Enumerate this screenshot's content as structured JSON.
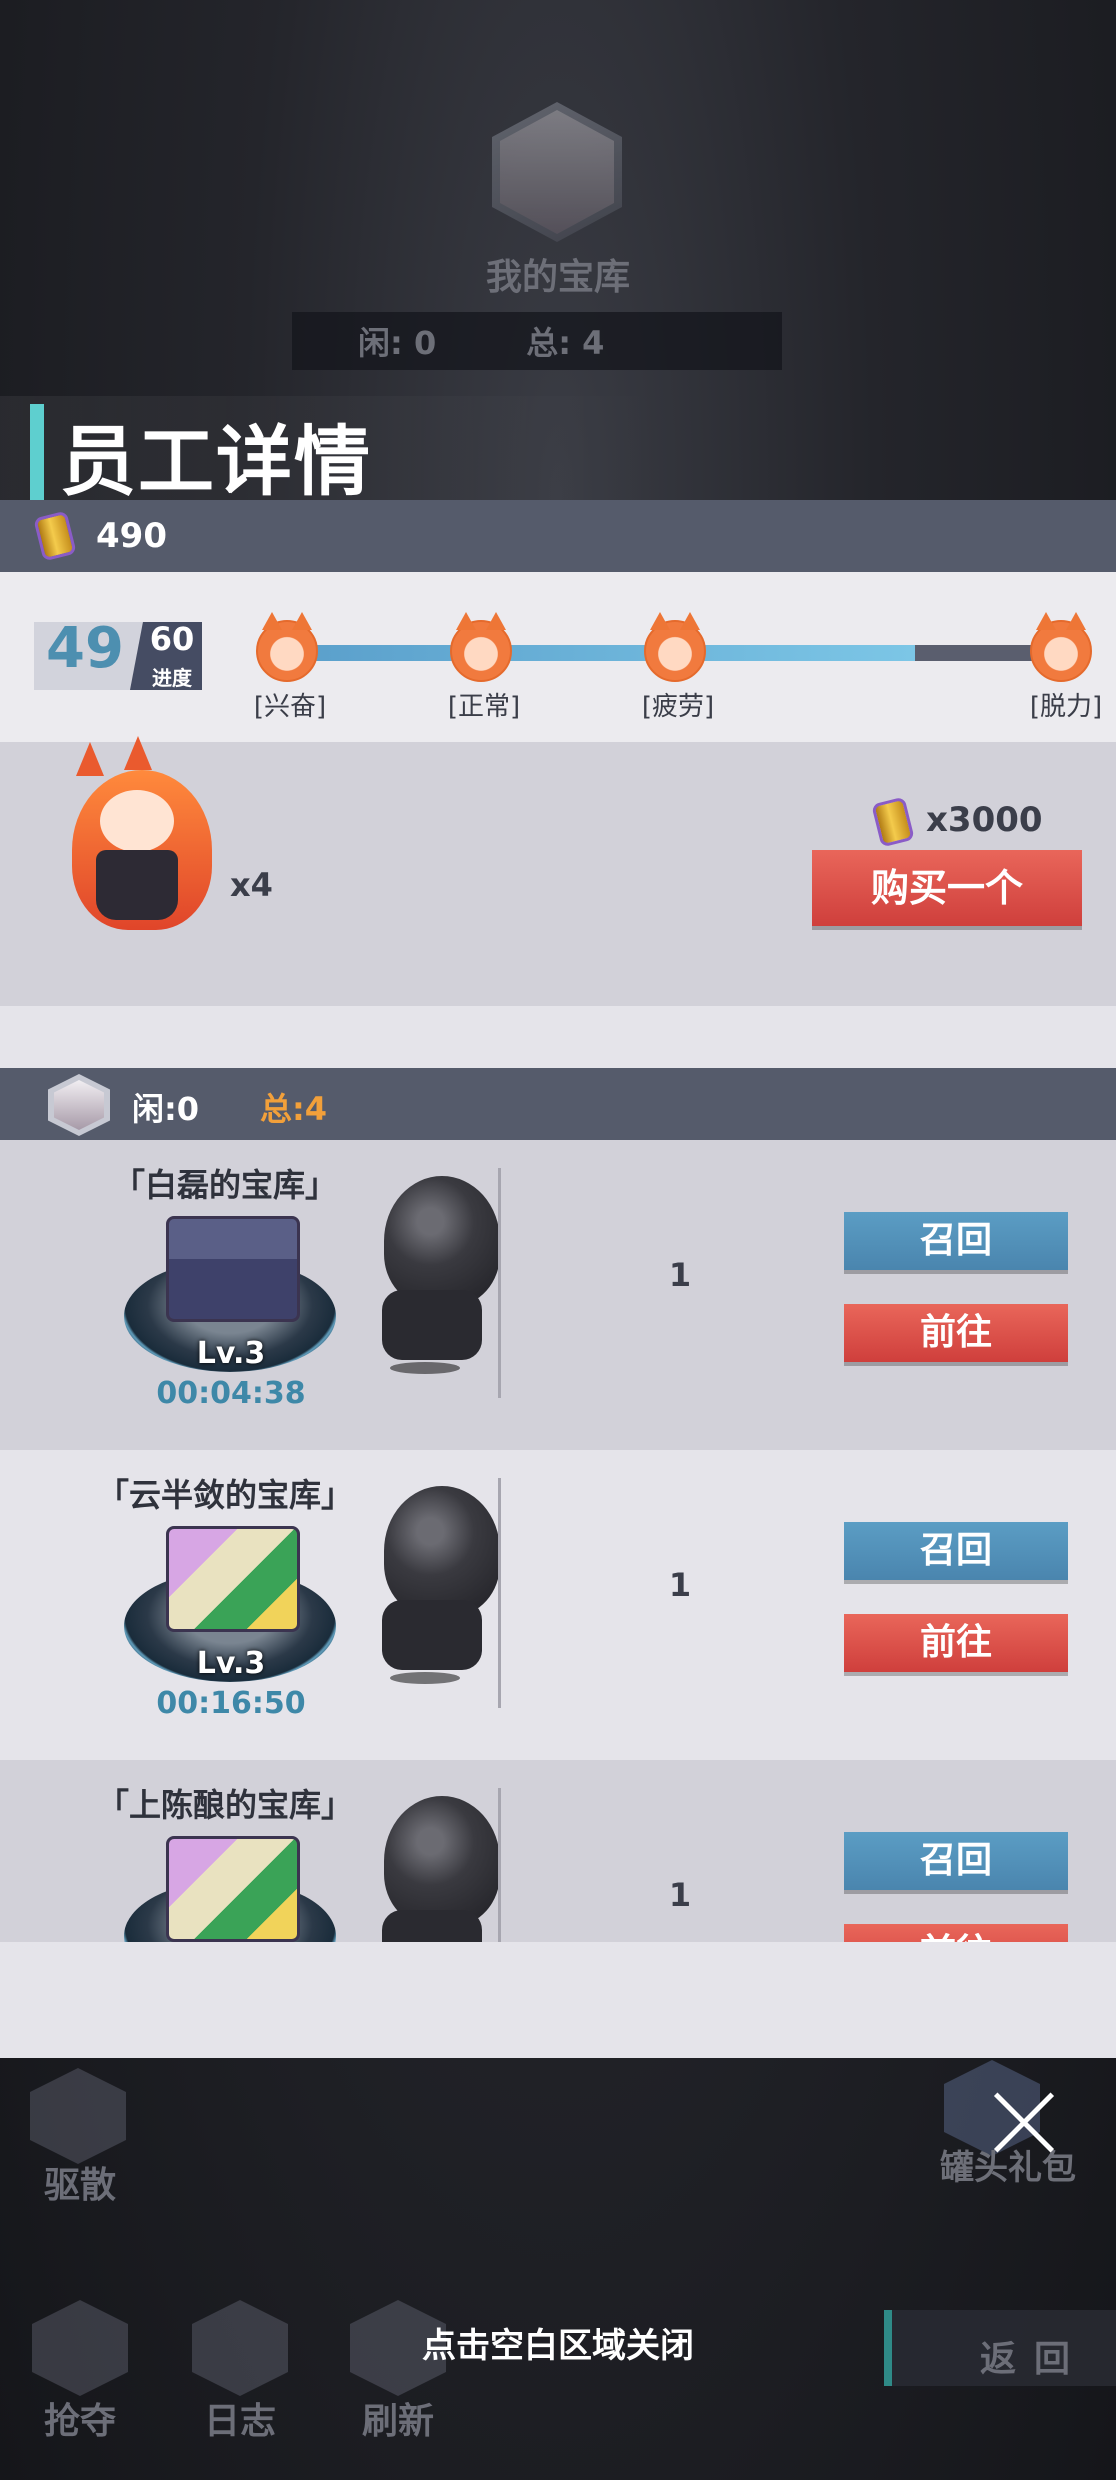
{
  "background": {
    "vault_title": "我的宝库",
    "idle_label": "闲: 0",
    "total_label": "总: 4"
  },
  "panel": {
    "title": "员工详情",
    "currency_value": "490"
  },
  "progress": {
    "current": "49",
    "max": "60",
    "label": "进度",
    "fraction": 0.82,
    "stages": [
      "[兴奋]",
      "[正常]",
      "[疲劳]",
      "[脱力]"
    ]
  },
  "employee": {
    "count": "x4",
    "price": "x3000",
    "buy_label": "购买一个"
  },
  "list_header": {
    "idle": "闲:0",
    "total": "总:4"
  },
  "vaults": [
    {
      "name": "「白磊的宝库」",
      "level": "Lv.3",
      "timer": "00:04:38",
      "count": "1",
      "recall": "召回",
      "goto": "前往"
    },
    {
      "name": "「云半敛的宝库」",
      "level": "Lv.3",
      "timer": "00:16:50",
      "count": "1",
      "recall": "召回",
      "goto": "前往"
    },
    {
      "name": "「上陈酿的宝库」",
      "level": "",
      "timer": "",
      "count": "1",
      "recall": "召回",
      "goto": "前往"
    }
  ],
  "bottom": {
    "disperse": "驱散",
    "gift": "罐头礼包",
    "plunder": "抢夺",
    "log": "日志",
    "refresh": "刷新",
    "close_hint": "点击空白区域关闭",
    "back": "返回"
  }
}
